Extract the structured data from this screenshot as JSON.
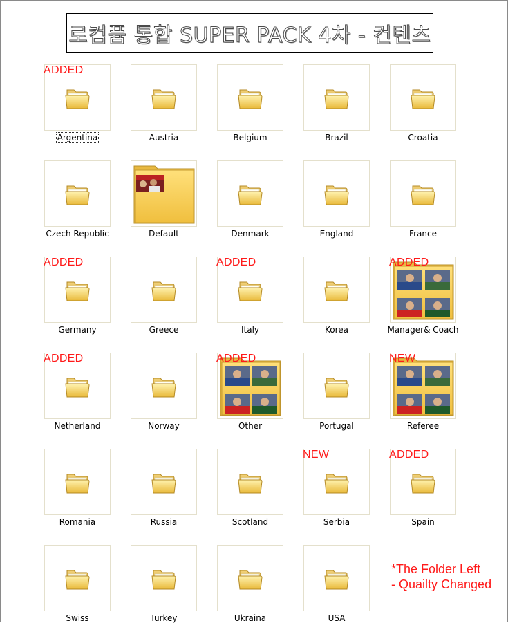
{
  "title": "로컴퓸 통합 SUPER PACK 4차 - 컨텐츠",
  "folders": [
    {
      "name": "Argentina",
      "badge": "ADDED",
      "selected": true
    },
    {
      "name": "Austria",
      "badge": ""
    },
    {
      "name": "Belgium",
      "badge": ""
    },
    {
      "name": "Brazil",
      "badge": ""
    },
    {
      "name": "Croatia",
      "badge": ""
    },
    {
      "name": "Czech Republic",
      "badge": ""
    },
    {
      "name": "Default",
      "badge": "",
      "thumb": true
    },
    {
      "name": "Denmark",
      "badge": ""
    },
    {
      "name": "England",
      "badge": ""
    },
    {
      "name": "France",
      "badge": ""
    },
    {
      "name": "Germany",
      "badge": "ADDED"
    },
    {
      "name": "Greece",
      "badge": ""
    },
    {
      "name": "Italy",
      "badge": "ADDED"
    },
    {
      "name": "Korea",
      "badge": ""
    },
    {
      "name": "Manager& Coach",
      "badge": "ADDED",
      "thumb": true
    },
    {
      "name": "Netherland",
      "badge": "ADDED"
    },
    {
      "name": "Norway",
      "badge": ""
    },
    {
      "name": "Other",
      "badge": "ADDED",
      "thumb": true
    },
    {
      "name": "Portugal",
      "badge": ""
    },
    {
      "name": "Referee",
      "badge": "NEW",
      "thumb": true
    },
    {
      "name": "Romania",
      "badge": ""
    },
    {
      "name": "Russia",
      "badge": ""
    },
    {
      "name": "Scotland",
      "badge": ""
    },
    {
      "name": "Serbia",
      "badge": "NEW"
    },
    {
      "name": "Spain",
      "badge": "ADDED"
    },
    {
      "name": "Swiss",
      "badge": ""
    },
    {
      "name": "Turkey",
      "badge": ""
    },
    {
      "name": "Ukraina",
      "badge": ""
    },
    {
      "name": "USA",
      "badge": ""
    }
  ],
  "note": {
    "line1": "*The Folder Left",
    "line2": "- Quailty Changed"
  },
  "colors": {
    "badge": "#ff1a1a",
    "folder_front": "#f6d96a",
    "folder_back": "#e9c24c"
  },
  "icons": {
    "folder": "folder-icon",
    "thumbnail_folder": "folder-thumbnail-icon"
  }
}
